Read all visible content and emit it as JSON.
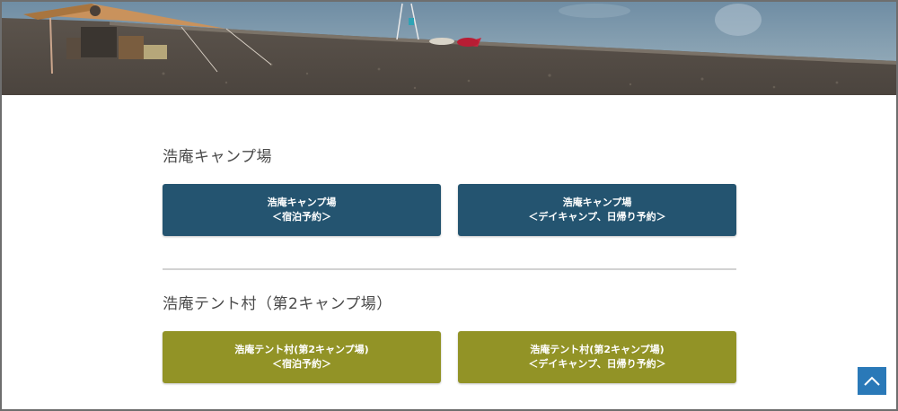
{
  "hero": {
    "description_icon": "lakeside-campsite-photo"
  },
  "sections": [
    {
      "title": "浩庵キャンプ場",
      "buttons": [
        {
          "line1": "浩庵キャンプ場",
          "line2": "＜宿泊予約＞"
        },
        {
          "line1": "浩庵キャンプ場",
          "line2": "＜デイキャンプ、日帰り予約＞"
        }
      ]
    },
    {
      "title": "浩庵テント村（第2キャンプ場）",
      "buttons": [
        {
          "line1": "浩庵テント村(第2キャンプ場)",
          "line2": "＜宿泊予約＞"
        },
        {
          "line1": "浩庵テント村(第2キャンプ場)",
          "line2": "＜デイキャンプ、日帰り予約＞"
        }
      ]
    }
  ],
  "colors": {
    "button_blue": "#245470",
    "button_olive": "#929326",
    "scroll_top": "#2a79b8"
  },
  "scroll_top_icon": "chevron-up-icon"
}
